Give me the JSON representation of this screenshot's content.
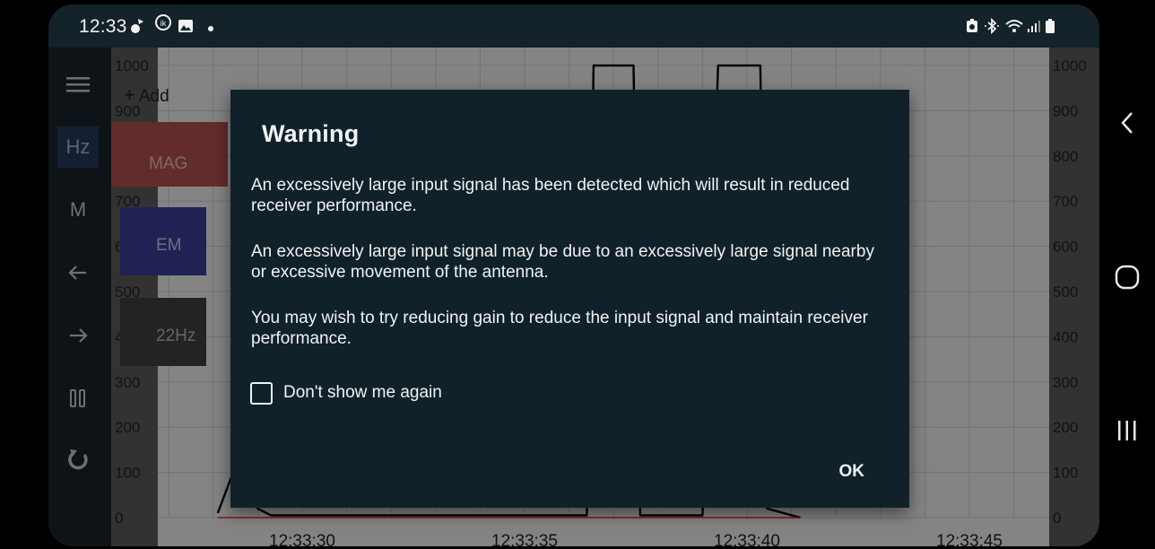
{
  "status_bar": {
    "time": "12:33",
    "left_icons": [
      "drone-icon",
      "ik-trax-icon",
      "image-icon"
    ],
    "right_icons": [
      "battery-saver-icon",
      "bluetooth-icon",
      "wifi-icon",
      "signal-icon",
      "battery-icon"
    ]
  },
  "toolbar": {
    "hz_label": "Hz",
    "m_label": "M"
  },
  "chart": {
    "add_label": "Add",
    "chips": {
      "mag": "MAG",
      "em": "EM",
      "hz22": "22Hz"
    },
    "colors": {
      "mag": "#b45050",
      "em": "#3b3f9a",
      "hz22": "#404040",
      "background": "#f0f0f0"
    }
  },
  "chart_data": {
    "type": "line",
    "ylim": [
      0,
      1000
    ],
    "yticks": [
      "0",
      "100",
      "200",
      "300",
      "400",
      "500",
      "600",
      "700",
      "800",
      "900",
      "1000"
    ],
    "xticks": [
      "12:33:30",
      "12:33:35",
      "12:33:40",
      "12:33:45"
    ],
    "series": [
      {
        "color": "#000000",
        "points": [
          {
            "t": 28.1,
            "y": 10
          },
          {
            "t": 28.6,
            "y": 140
          },
          {
            "t": 29.0,
            "y": 20
          },
          {
            "t": 29.3,
            "y": 5
          },
          {
            "t": 34.0,
            "y": 5
          },
          {
            "t": 35.0,
            "y": 5
          },
          {
            "t": 36.4,
            "y": 5
          },
          {
            "t": 36.55,
            "y": 1000
          },
          {
            "t": 37.45,
            "y": 1000
          },
          {
            "t": 37.6,
            "y": 5
          },
          {
            "t": 39.0,
            "y": 5
          },
          {
            "t": 39.35,
            "y": 1000
          },
          {
            "t": 40.3,
            "y": 1000
          },
          {
            "t": 40.45,
            "y": 20
          },
          {
            "t": 41.2,
            "y": 0
          }
        ]
      },
      {
        "color": "#e03030",
        "points": [
          {
            "t": 28.1,
            "y": 0
          },
          {
            "t": 41.2,
            "y": 0
          }
        ]
      }
    ]
  },
  "dialog": {
    "title": "Warning",
    "p1": "An excessively large input signal has been detected which will result in reduced receiver performance.",
    "p2": "An excessively large input signal may be due to an excessively large signal nearby or excessive movement of the antenna.",
    "p3": "You may wish to try reducing gain to reduce the input signal and maintain receiver performance.",
    "checkbox_label": "Don't show me again",
    "checkbox_checked": false,
    "ok_label": "OK"
  }
}
